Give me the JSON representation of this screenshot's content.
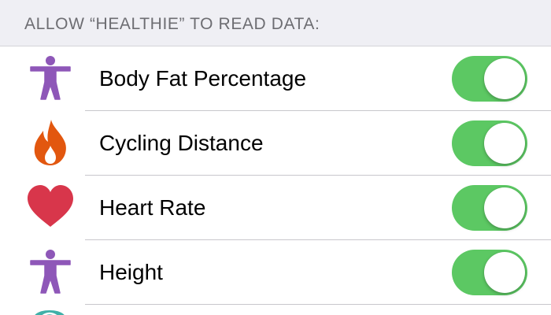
{
  "header": {
    "title": "ALLOW “HEALTHIE” TO READ DATA:"
  },
  "rows": [
    {
      "label": "Body Fat Percentage",
      "icon": "body-measurement-icon",
      "icon_color": "#8e57b8",
      "enabled": true
    },
    {
      "label": "Cycling Distance",
      "icon": "flame-activity-icon",
      "icon_color": "#e2570f",
      "enabled": true
    },
    {
      "label": "Heart Rate",
      "icon": "heart-icon",
      "icon_color": "#d8364b",
      "enabled": true
    },
    {
      "label": "Height",
      "icon": "body-measurement-icon",
      "icon_color": "#8e57b8",
      "enabled": true
    }
  ],
  "partial_row_icon": "teal-category-icon",
  "colors": {
    "toggle_on": "#5cc863",
    "header_bg": "#efeff4",
    "header_text": "#6d6d72",
    "partial_icon": "#3fb0a8"
  }
}
